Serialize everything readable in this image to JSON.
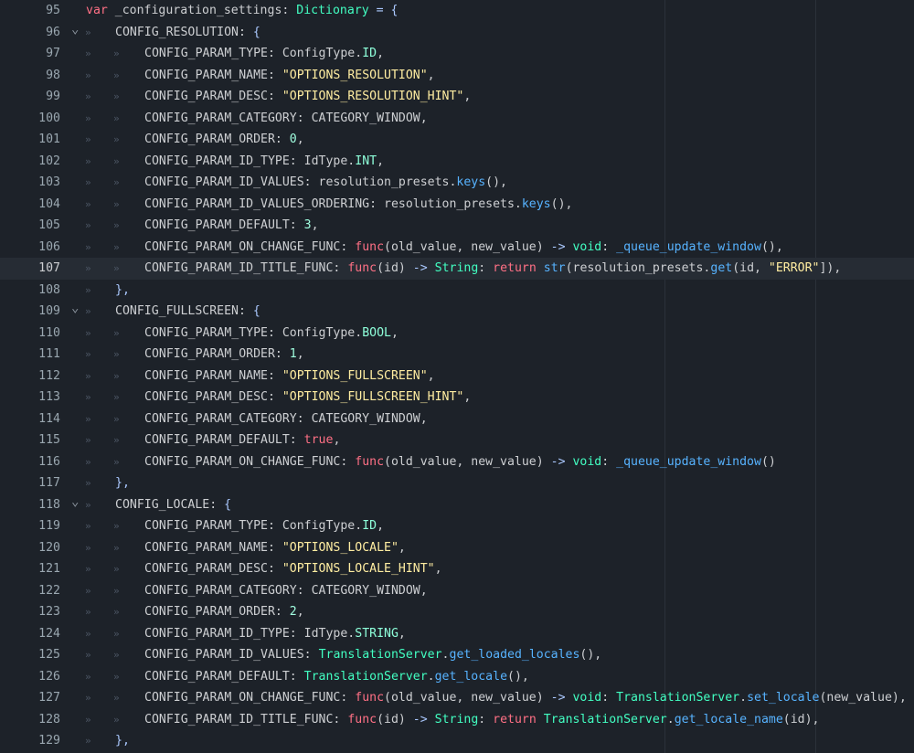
{
  "editor": {
    "first_line": 95,
    "current_line": 107,
    "lines": [
      {
        "n": "95",
        "indent": 0,
        "fold": "",
        "tokens": [
          [
            "key",
            "var"
          ],
          [
            "txt",
            " _configuration_settings: "
          ],
          [
            "type",
            "Dictionary"
          ],
          [
            "sym",
            " = {"
          ]
        ]
      },
      {
        "n": "96",
        "indent": 1,
        "fold": "v",
        "tokens": [
          [
            "txt",
            "CONFIG_RESOLUTION: "
          ],
          [
            "sym",
            "{"
          ]
        ]
      },
      {
        "n": "97",
        "indent": 2,
        "fold": "",
        "tokens": [
          [
            "txt",
            "CONFIG_PARAM_TYPE: ConfigType."
          ],
          [
            "cls",
            "ID"
          ],
          [
            "txt",
            ","
          ]
        ]
      },
      {
        "n": "98",
        "indent": 2,
        "fold": "",
        "tokens": [
          [
            "txt",
            "CONFIG_PARAM_NAME: "
          ],
          [
            "str",
            "\"OPTIONS_RESOLUTION\""
          ],
          [
            "txt",
            ","
          ]
        ]
      },
      {
        "n": "99",
        "indent": 2,
        "fold": "",
        "tokens": [
          [
            "txt",
            "CONFIG_PARAM_DESC: "
          ],
          [
            "str",
            "\"OPTIONS_RESOLUTION_HINT\""
          ],
          [
            "txt",
            ","
          ]
        ]
      },
      {
        "n": "100",
        "indent": 2,
        "fold": "",
        "tokens": [
          [
            "txt",
            "CONFIG_PARAM_CATEGORY: CATEGORY_WINDOW,"
          ]
        ]
      },
      {
        "n": "101",
        "indent": 2,
        "fold": "",
        "tokens": [
          [
            "txt",
            "CONFIG_PARAM_ORDER: "
          ],
          [
            "num",
            "0"
          ],
          [
            "txt",
            ","
          ]
        ]
      },
      {
        "n": "102",
        "indent": 2,
        "fold": "",
        "tokens": [
          [
            "txt",
            "CONFIG_PARAM_ID_TYPE: IdType."
          ],
          [
            "cls",
            "INT"
          ],
          [
            "txt",
            ","
          ]
        ]
      },
      {
        "n": "103",
        "indent": 2,
        "fold": "",
        "tokens": [
          [
            "txt",
            "CONFIG_PARAM_ID_VALUES: resolution_presets."
          ],
          [
            "fn",
            "keys"
          ],
          [
            "txt",
            "(),"
          ]
        ]
      },
      {
        "n": "104",
        "indent": 2,
        "fold": "",
        "tokens": [
          [
            "txt",
            "CONFIG_PARAM_ID_VALUES_ORDERING: resolution_presets."
          ],
          [
            "fn",
            "keys"
          ],
          [
            "txt",
            "(),"
          ]
        ]
      },
      {
        "n": "105",
        "indent": 2,
        "fold": "",
        "tokens": [
          [
            "txt",
            "CONFIG_PARAM_DEFAULT: "
          ],
          [
            "num",
            "3"
          ],
          [
            "txt",
            ","
          ]
        ]
      },
      {
        "n": "106",
        "indent": 2,
        "fold": "",
        "tokens": [
          [
            "txt",
            "CONFIG_PARAM_ON_CHANGE_FUNC: "
          ],
          [
            "key",
            "func"
          ],
          [
            "txt",
            "(old_value, new_value) "
          ],
          [
            "sym",
            "->"
          ],
          [
            "txt",
            " "
          ],
          [
            "type",
            "void"
          ],
          [
            "txt",
            ": "
          ],
          [
            "fn",
            "_queue_update_window"
          ],
          [
            "txt",
            "(),"
          ]
        ]
      },
      {
        "n": "107",
        "indent": 2,
        "fold": "",
        "tokens": [
          [
            "txt",
            "CONFIG_PARAM_ID_TITLE_FUNC: "
          ],
          [
            "key",
            "func"
          ],
          [
            "txt",
            "(id) "
          ],
          [
            "sym",
            "->"
          ],
          [
            "txt",
            " "
          ],
          [
            "type",
            "String"
          ],
          [
            "txt",
            ": "
          ],
          [
            "key",
            "return"
          ],
          [
            "txt",
            " "
          ],
          [
            "fn",
            "str"
          ],
          [
            "txt",
            "(resolution_presets."
          ],
          [
            "fn",
            "get"
          ],
          [
            "txt",
            "(id, "
          ],
          [
            "str",
            "\"ERROR\""
          ],
          [
            "txt",
            "]),"
          ]
        ]
      },
      {
        "n": "108",
        "indent": 1,
        "fold": "",
        "tokens": [
          [
            "sym",
            "},"
          ]
        ]
      },
      {
        "n": "109",
        "indent": 1,
        "fold": "v",
        "tokens": [
          [
            "txt",
            "CONFIG_FULLSCREEN: "
          ],
          [
            "sym",
            "{"
          ]
        ]
      },
      {
        "n": "110",
        "indent": 2,
        "fold": "",
        "tokens": [
          [
            "txt",
            "CONFIG_PARAM_TYPE: ConfigType."
          ],
          [
            "cls",
            "BOOL"
          ],
          [
            "txt",
            ","
          ]
        ]
      },
      {
        "n": "111",
        "indent": 2,
        "fold": "",
        "tokens": [
          [
            "txt",
            "CONFIG_PARAM_ORDER: "
          ],
          [
            "num",
            "1"
          ],
          [
            "txt",
            ","
          ]
        ]
      },
      {
        "n": "112",
        "indent": 2,
        "fold": "",
        "tokens": [
          [
            "txt",
            "CONFIG_PARAM_NAME: "
          ],
          [
            "str",
            "\"OPTIONS_FULLSCREEN\""
          ],
          [
            "txt",
            ","
          ]
        ]
      },
      {
        "n": "113",
        "indent": 2,
        "fold": "",
        "tokens": [
          [
            "txt",
            "CONFIG_PARAM_DESC: "
          ],
          [
            "str",
            "\"OPTIONS_FULLSCREEN_HINT\""
          ],
          [
            "txt",
            ","
          ]
        ]
      },
      {
        "n": "114",
        "indent": 2,
        "fold": "",
        "tokens": [
          [
            "txt",
            "CONFIG_PARAM_CATEGORY: CATEGORY_WINDOW,"
          ]
        ]
      },
      {
        "n": "115",
        "indent": 2,
        "fold": "",
        "tokens": [
          [
            "txt",
            "CONFIG_PARAM_DEFAULT: "
          ],
          [
            "key",
            "true"
          ],
          [
            "txt",
            ","
          ]
        ]
      },
      {
        "n": "116",
        "indent": 2,
        "fold": "",
        "tokens": [
          [
            "txt",
            "CONFIG_PARAM_ON_CHANGE_FUNC: "
          ],
          [
            "key",
            "func"
          ],
          [
            "txt",
            "(old_value, new_value) "
          ],
          [
            "sym",
            "->"
          ],
          [
            "txt",
            " "
          ],
          [
            "type",
            "void"
          ],
          [
            "txt",
            ": "
          ],
          [
            "fn",
            "_queue_update_window"
          ],
          [
            "txt",
            "()"
          ]
        ]
      },
      {
        "n": "117",
        "indent": 1,
        "fold": "",
        "tokens": [
          [
            "sym",
            "},"
          ]
        ]
      },
      {
        "n": "118",
        "indent": 1,
        "fold": "v",
        "tokens": [
          [
            "txt",
            "CONFIG_LOCALE: "
          ],
          [
            "sym",
            "{"
          ]
        ]
      },
      {
        "n": "119",
        "indent": 2,
        "fold": "",
        "tokens": [
          [
            "txt",
            "CONFIG_PARAM_TYPE: ConfigType."
          ],
          [
            "cls",
            "ID"
          ],
          [
            "txt",
            ","
          ]
        ]
      },
      {
        "n": "120",
        "indent": 2,
        "fold": "",
        "tokens": [
          [
            "txt",
            "CONFIG_PARAM_NAME: "
          ],
          [
            "str",
            "\"OPTIONS_LOCALE\""
          ],
          [
            "txt",
            ","
          ]
        ]
      },
      {
        "n": "121",
        "indent": 2,
        "fold": "",
        "tokens": [
          [
            "txt",
            "CONFIG_PARAM_DESC: "
          ],
          [
            "str",
            "\"OPTIONS_LOCALE_HINT\""
          ],
          [
            "txt",
            ","
          ]
        ]
      },
      {
        "n": "122",
        "indent": 2,
        "fold": "",
        "tokens": [
          [
            "txt",
            "CONFIG_PARAM_CATEGORY: CATEGORY_WINDOW,"
          ]
        ]
      },
      {
        "n": "123",
        "indent": 2,
        "fold": "",
        "tokens": [
          [
            "txt",
            "CONFIG_PARAM_ORDER: "
          ],
          [
            "num",
            "2"
          ],
          [
            "txt",
            ","
          ]
        ]
      },
      {
        "n": "124",
        "indent": 2,
        "fold": "",
        "tokens": [
          [
            "txt",
            "CONFIG_PARAM_ID_TYPE: IdType."
          ],
          [
            "cls",
            "STRING"
          ],
          [
            "txt",
            ","
          ]
        ]
      },
      {
        "n": "125",
        "indent": 2,
        "fold": "",
        "tokens": [
          [
            "txt",
            "CONFIG_PARAM_ID_VALUES: "
          ],
          [
            "type",
            "TranslationServer"
          ],
          [
            "txt",
            "."
          ],
          [
            "fn",
            "get_loaded_locales"
          ],
          [
            "txt",
            "(),"
          ]
        ]
      },
      {
        "n": "126",
        "indent": 2,
        "fold": "",
        "tokens": [
          [
            "txt",
            "CONFIG_PARAM_DEFAULT: "
          ],
          [
            "type",
            "TranslationServer"
          ],
          [
            "txt",
            "."
          ],
          [
            "fn",
            "get_locale"
          ],
          [
            "txt",
            "(),"
          ]
        ]
      },
      {
        "n": "127",
        "indent": 2,
        "fold": "",
        "tokens": [
          [
            "txt",
            "CONFIG_PARAM_ON_CHANGE_FUNC: "
          ],
          [
            "key",
            "func"
          ],
          [
            "txt",
            "(old_value, new_value) "
          ],
          [
            "sym",
            "->"
          ],
          [
            "txt",
            " "
          ],
          [
            "type",
            "void"
          ],
          [
            "txt",
            ": "
          ],
          [
            "type",
            "TranslationServer"
          ],
          [
            "txt",
            "."
          ],
          [
            "fn",
            "set_locale"
          ],
          [
            "txt",
            "(new_value),"
          ]
        ]
      },
      {
        "n": "128",
        "indent": 2,
        "fold": "",
        "tokens": [
          [
            "txt",
            "CONFIG_PARAM_ID_TITLE_FUNC: "
          ],
          [
            "key",
            "func"
          ],
          [
            "txt",
            "(id) "
          ],
          [
            "sym",
            "->"
          ],
          [
            "txt",
            " "
          ],
          [
            "type",
            "String"
          ],
          [
            "txt",
            ": "
          ],
          [
            "key",
            "return"
          ],
          [
            "txt",
            " "
          ],
          [
            "type",
            "TranslationServer"
          ],
          [
            "txt",
            "."
          ],
          [
            "fn",
            "get_locale_name"
          ],
          [
            "txt",
            "(id),"
          ]
        ]
      },
      {
        "n": "129",
        "indent": 1,
        "fold": "",
        "tokens": [
          [
            "sym",
            "},"
          ]
        ]
      }
    ]
  },
  "icons": {
    "fold": "chevron-down-icon",
    "tab": "tab-indent-icon"
  }
}
